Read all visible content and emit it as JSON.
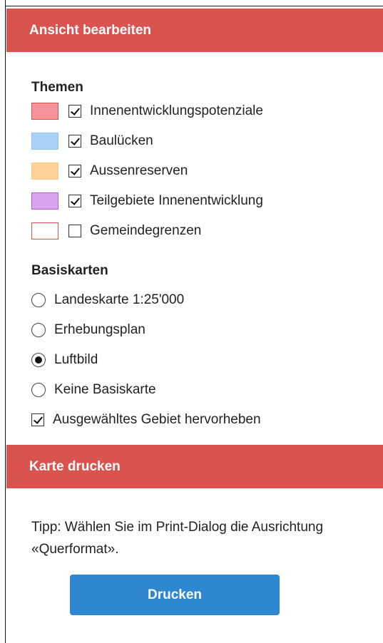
{
  "edit_section": {
    "title": "Ansicht bearbeiten",
    "themes_title": "Themen",
    "themes": [
      {
        "label": "Innenentwicklungspotenziale",
        "checked": true,
        "fill": "#f4949a",
        "border": "#d9534f"
      },
      {
        "label": "Baulücken",
        "checked": true,
        "fill": "#a9d1f7",
        "border": "#8ec3f2"
      },
      {
        "label": "Aussenreserven",
        "checked": true,
        "fill": "#fdd197",
        "border": "#f7c585"
      },
      {
        "label": "Teilgebiete Innenentwicklung",
        "checked": true,
        "fill": "#d9a3ee",
        "border": "#b05fd8"
      },
      {
        "label": "Gemeindegrenzen",
        "checked": false,
        "fill": "#ffffff",
        "border": "#d9534f"
      }
    ],
    "basemaps_title": "Basiskarten",
    "basemaps": [
      {
        "label": "Landeskarte 1:25'000",
        "selected": false
      },
      {
        "label": "Erhebungsplan",
        "selected": false
      },
      {
        "label": "Luftbild",
        "selected": true
      },
      {
        "label": "Keine Basiskarte",
        "selected": false
      }
    ],
    "highlight": {
      "label": "Ausgewähltes Gebiet hervorheben",
      "checked": true
    }
  },
  "print_section": {
    "title": "Karte drucken",
    "tip": "Tipp: Wählen Sie im Print-Dialog die Ausrichtung «Querformat».",
    "button_label": "Drucken"
  },
  "colors": {
    "header": "#d9534f",
    "button": "#2f86d1"
  }
}
